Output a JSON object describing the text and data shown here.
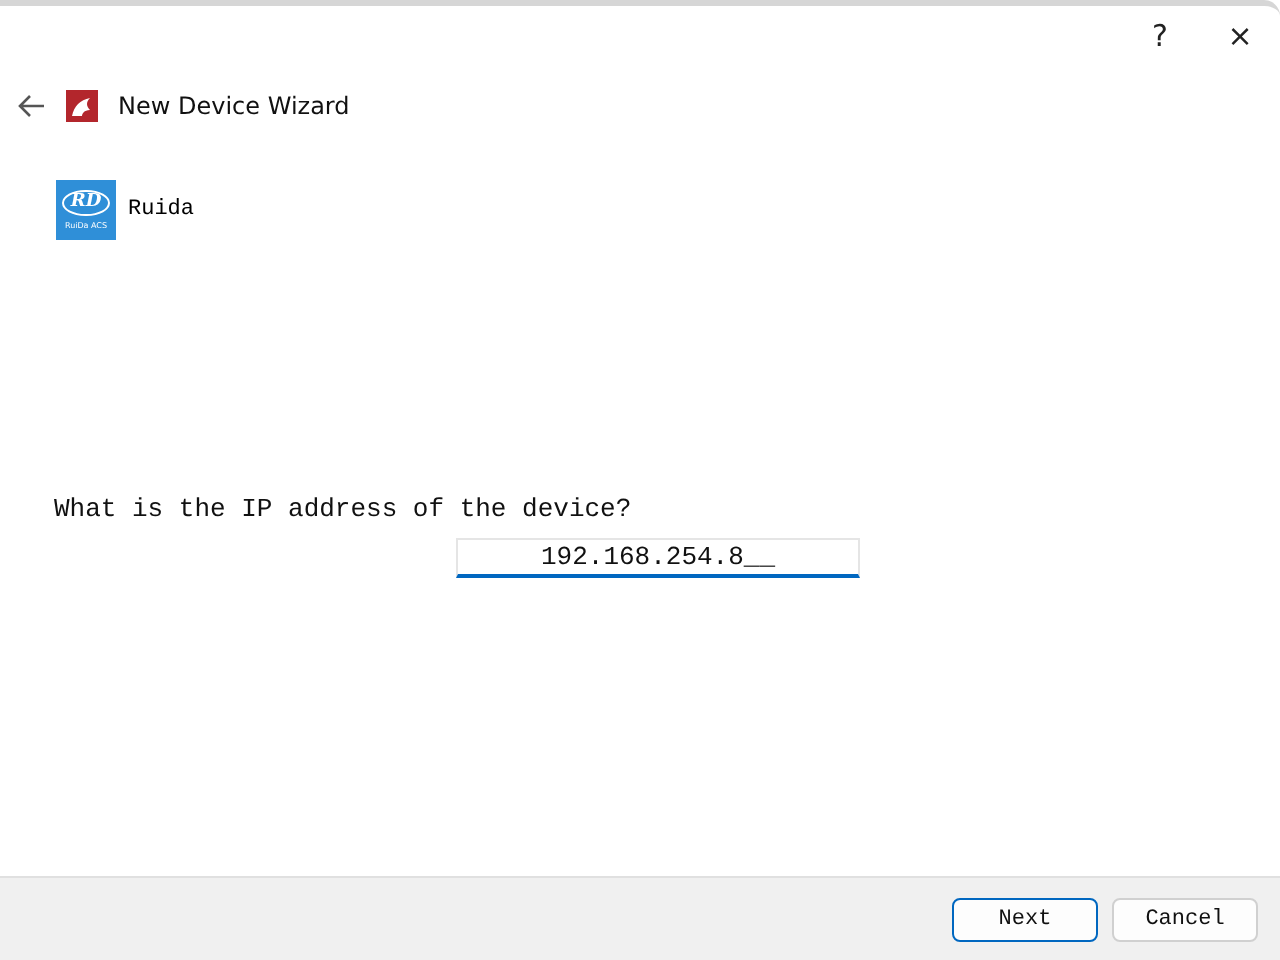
{
  "title_bar": {
    "help": "?",
    "close": "×"
  },
  "header": {
    "title": "New Device Wizard"
  },
  "device": {
    "logo_mark": "RD",
    "logo_caption": "RuiDa ACS",
    "name": "Ruida"
  },
  "question": "What is the IP address of the device?",
  "ip_field": {
    "value": "192.168.254.8__",
    "focused": true
  },
  "buttons": [
    {
      "label": "Next",
      "default": true
    },
    {
      "label": "Cancel",
      "default": false
    }
  ]
}
